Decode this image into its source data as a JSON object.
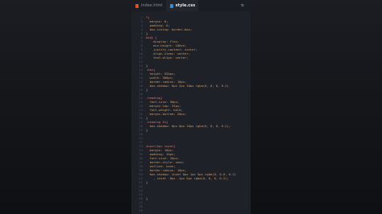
{
  "tabs": [
    {
      "label": "index.html",
      "icon": "html-file-icon",
      "active": false
    },
    {
      "label": "style.css",
      "icon": "css-file-icon",
      "active": true
    }
  ],
  "code_lines": [
    {
      "t": "*{",
      "k": "sel"
    },
    {
      "t": "  margin: 0;",
      "k": "prop"
    },
    {
      "t": "  padding: 0;",
      "k": "prop"
    },
    {
      "t": "  box-sizing: border-box;",
      "k": "prop"
    },
    {
      "t": "}",
      "k": "br"
    },
    {
      "t": "body {",
      "k": "sel"
    },
    {
      "t": "    display: flex;",
      "k": "prop"
    },
    {
      "t": "    min-height: 100vh;",
      "k": "prop"
    },
    {
      "t": "    justify-content: center;",
      "k": "prop"
    },
    {
      "t": "    align-items: center;",
      "k": "prop"
    },
    {
      "t": "    text-align: center;",
      "k": "prop"
    },
    {
      "t": "",
      "k": "br"
    },
    {
      "t": "}",
      "k": "br"
    },
    {
      "t": ".box{",
      "k": "sel"
    },
    {
      "t": "  height: 520px;",
      "k": "prop"
    },
    {
      "t": "  width: 300px;",
      "k": "prop"
    },
    {
      "t": "  border-radius: 10px;",
      "k": "prop"
    },
    {
      "t": "  box-shadow: 0px 2px 10px rgba(0, 0, 0, 0.2)",
      "k": "prop"
    },
    {
      "t": "}",
      "k": "br"
    },
    {
      "t": "",
      "k": "br"
    },
    {
      "t": ".heading{",
      "k": "sel"
    },
    {
      "t": "  font-size: 30px;",
      "k": "prop"
    },
    {
      "t": "  margin-top: 25px;",
      "k": "prop"
    },
    {
      "t": "  font-weight: bold;",
      "k": "prop"
    },
    {
      "t": "  margin-bottom: 20px;",
      "k": "prop"
    },
    {
      "t": "}",
      "k": "br"
    },
    {
      "t": ".heading h1{",
      "k": "sel"
    },
    {
      "t": "  box-shadow: 0px 0px 10px rgba(0, 0, 0, 0.2);",
      "k": "prop"
    },
    {
      "t": "}",
      "k": "br"
    },
    {
      "t": "",
      "k": "br"
    },
    {
      "t": "",
      "k": "br"
    },
    {
      "t": "",
      "k": "br"
    },
    {
      "t": "input(box input{",
      "k": "sel"
    },
    {
      "t": "  margin: 10px;",
      "k": "prop"
    },
    {
      "t": "  padding: 10px;",
      "k": "prop"
    },
    {
      "t": "  font-size: 16px;",
      "k": "prop"
    },
    {
      "t": "  border-style: none;",
      "k": "prop"
    },
    {
      "t": "  outline: none;",
      "k": "prop"
    },
    {
      "t": "  border-radius: 10px;",
      "k": "prop"
    },
    {
      "t": "  box-shadow: inset 0px 1px 5px rgba(0, 0.0, 0.2)",
      "k": "prop"
    },
    {
      "t": "    , inset -0px -1px 5px rgba(0, 0, 0, 0.2);",
      "k": "prop"
    },
    {
      "t": "}",
      "k": "br"
    },
    {
      "t": "",
      "k": "br"
    },
    {
      "t": "",
      "k": "br"
    },
    {
      "t": "",
      "k": "br"
    },
    {
      "t": "}",
      "k": "br"
    },
    {
      "t": "",
      "k": "br"
    },
    {
      "t": "",
      "k": "br"
    },
    {
      "t": "",
      "k": "br"
    }
  ],
  "colors": {
    "background": "#1e2127",
    "selector": "#e06c75",
    "property": "#d19a66",
    "line_number": "#4b5160"
  }
}
